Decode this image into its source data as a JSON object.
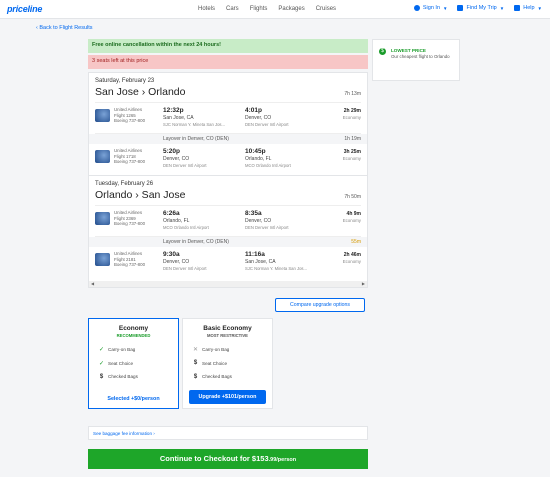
{
  "header": {
    "logo": "priceline",
    "nav": [
      "Hotels",
      "Cars",
      "Flights",
      "Packages",
      "Cruises"
    ],
    "sign_in": "Sign In",
    "find_trip": "Find My Trip",
    "help": "Help"
  },
  "back_link": "‹ Back to Flight Results",
  "banners": {
    "free_cancel": "Free online cancellation within the next 24 hours!",
    "seats_left": "3 seats left at this price"
  },
  "side": {
    "title": "LOWEST PRICE",
    "text": "Our cheapest flight to Orlando"
  },
  "outbound": {
    "date": "Saturday, February 23",
    "route": "San Jose › Orlando",
    "duration": "7h 13m",
    "segments": [
      {
        "airline": "United Airlines",
        "flight": "Flight 1265",
        "aircraft": "Boeing 737-800",
        "dep_time": "12:32p",
        "dep_city": "San Jose, CA",
        "dep_airport": "SJC Norman Y. Mineta San Jos...",
        "arr_time": "4:01p",
        "arr_city": "Denver, CO",
        "arr_airport": "DEN Denver Intl Airport",
        "dur": "2h 29m",
        "cabin": "Economy"
      },
      {
        "airline": "United Airlines",
        "flight": "Flight 1718",
        "aircraft": "Boeing 737-800",
        "dep_time": "5:20p",
        "dep_city": "Denver, CO",
        "dep_airport": "DEN Denver Intl Airport",
        "arr_time": "10:45p",
        "arr_city": "Orlando, FL",
        "arr_airport": "MCO Orlando Intl Airport",
        "dur": "3h 25m",
        "cabin": "Economy"
      }
    ],
    "layover": "Layover in Denver, CO (DEN)",
    "layover_dur": "1h 19m"
  },
  "return": {
    "date": "Tuesday, February 26",
    "route": "Orlando › San Jose",
    "duration": "7h 50m",
    "segments": [
      {
        "airline": "United Airlines",
        "flight": "Flight 2369",
        "aircraft": "Boeing 737-800",
        "dep_time": "6:26a",
        "dep_city": "Orlando, FL",
        "dep_airport": "MCO Orlando Intl Airport",
        "arr_time": "8:35a",
        "arr_city": "Denver, CO",
        "arr_airport": "DEN Denver Intl Airport",
        "dur": "4h 9m",
        "cabin": "Economy"
      },
      {
        "airline": "United Airlines",
        "flight": "Flight 2181",
        "aircraft": "Boeing 737-800",
        "dep_time": "9:30a",
        "dep_city": "Denver, CO",
        "dep_airport": "DEN Denver Intl Airport",
        "arr_time": "11:16a",
        "arr_city": "San Jose, CA",
        "arr_airport": "SJC Norman Y. Mineta San Jos...",
        "dur": "2h 46m",
        "cabin": "Economy"
      }
    ],
    "layover": "Layover in Denver, CO (DEN)",
    "layover_dur": "55m"
  },
  "compare_button": "Compare upgrade options",
  "fares": {
    "economy": {
      "name": "Economy",
      "sub": "RECOMMENDED",
      "features": [
        "Carry-on Bag",
        "Seat Choice",
        "Checked Bags"
      ],
      "button": "Selected +$0/person"
    },
    "basic": {
      "name": "Basic Economy",
      "sub": "MOST RESTRICTIVE",
      "features": [
        "Carry-on Bag",
        "Seat Choice",
        "Checked Bags"
      ],
      "button": "Upgrade +$101/person"
    }
  },
  "baggage_link": "See baggage fee information  ›",
  "checkout": {
    "label": "Continue to Checkout for $153",
    "cents": ".99/person"
  },
  "colors": {
    "brand": "#0068ef",
    "checkout": "#1ea629",
    "green_banner": "#c8ecc7",
    "red_banner": "#f7c6c6"
  }
}
